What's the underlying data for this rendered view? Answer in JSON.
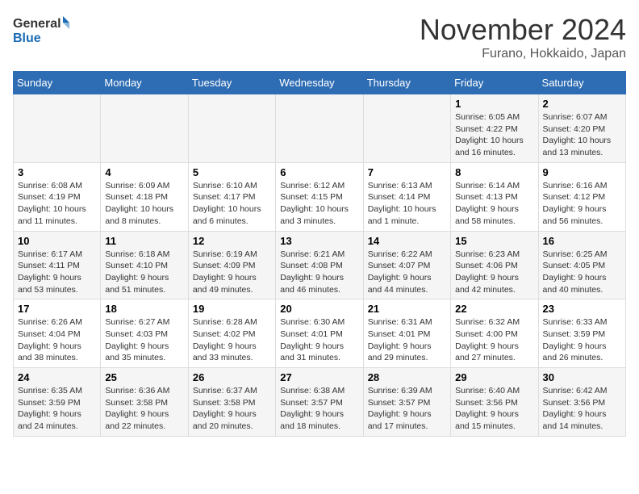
{
  "logo": {
    "general": "General",
    "blue": "Blue"
  },
  "title": "November 2024",
  "location": "Furano, Hokkaido, Japan",
  "weekdays": [
    "Sunday",
    "Monday",
    "Tuesday",
    "Wednesday",
    "Thursday",
    "Friday",
    "Saturday"
  ],
  "weeks": [
    [
      {
        "day": "",
        "info": ""
      },
      {
        "day": "",
        "info": ""
      },
      {
        "day": "",
        "info": ""
      },
      {
        "day": "",
        "info": ""
      },
      {
        "day": "",
        "info": ""
      },
      {
        "day": "1",
        "info": "Sunrise: 6:05 AM\nSunset: 4:22 PM\nDaylight: 10 hours and 16 minutes."
      },
      {
        "day": "2",
        "info": "Sunrise: 6:07 AM\nSunset: 4:20 PM\nDaylight: 10 hours and 13 minutes."
      }
    ],
    [
      {
        "day": "3",
        "info": "Sunrise: 6:08 AM\nSunset: 4:19 PM\nDaylight: 10 hours and 11 minutes."
      },
      {
        "day": "4",
        "info": "Sunrise: 6:09 AM\nSunset: 4:18 PM\nDaylight: 10 hours and 8 minutes."
      },
      {
        "day": "5",
        "info": "Sunrise: 6:10 AM\nSunset: 4:17 PM\nDaylight: 10 hours and 6 minutes."
      },
      {
        "day": "6",
        "info": "Sunrise: 6:12 AM\nSunset: 4:15 PM\nDaylight: 10 hours and 3 minutes."
      },
      {
        "day": "7",
        "info": "Sunrise: 6:13 AM\nSunset: 4:14 PM\nDaylight: 10 hours and 1 minute."
      },
      {
        "day": "8",
        "info": "Sunrise: 6:14 AM\nSunset: 4:13 PM\nDaylight: 9 hours and 58 minutes."
      },
      {
        "day": "9",
        "info": "Sunrise: 6:16 AM\nSunset: 4:12 PM\nDaylight: 9 hours and 56 minutes."
      }
    ],
    [
      {
        "day": "10",
        "info": "Sunrise: 6:17 AM\nSunset: 4:11 PM\nDaylight: 9 hours and 53 minutes."
      },
      {
        "day": "11",
        "info": "Sunrise: 6:18 AM\nSunset: 4:10 PM\nDaylight: 9 hours and 51 minutes."
      },
      {
        "day": "12",
        "info": "Sunrise: 6:19 AM\nSunset: 4:09 PM\nDaylight: 9 hours and 49 minutes."
      },
      {
        "day": "13",
        "info": "Sunrise: 6:21 AM\nSunset: 4:08 PM\nDaylight: 9 hours and 46 minutes."
      },
      {
        "day": "14",
        "info": "Sunrise: 6:22 AM\nSunset: 4:07 PM\nDaylight: 9 hours and 44 minutes."
      },
      {
        "day": "15",
        "info": "Sunrise: 6:23 AM\nSunset: 4:06 PM\nDaylight: 9 hours and 42 minutes."
      },
      {
        "day": "16",
        "info": "Sunrise: 6:25 AM\nSunset: 4:05 PM\nDaylight: 9 hours and 40 minutes."
      }
    ],
    [
      {
        "day": "17",
        "info": "Sunrise: 6:26 AM\nSunset: 4:04 PM\nDaylight: 9 hours and 38 minutes."
      },
      {
        "day": "18",
        "info": "Sunrise: 6:27 AM\nSunset: 4:03 PM\nDaylight: 9 hours and 35 minutes."
      },
      {
        "day": "19",
        "info": "Sunrise: 6:28 AM\nSunset: 4:02 PM\nDaylight: 9 hours and 33 minutes."
      },
      {
        "day": "20",
        "info": "Sunrise: 6:30 AM\nSunset: 4:01 PM\nDaylight: 9 hours and 31 minutes."
      },
      {
        "day": "21",
        "info": "Sunrise: 6:31 AM\nSunset: 4:01 PM\nDaylight: 9 hours and 29 minutes."
      },
      {
        "day": "22",
        "info": "Sunrise: 6:32 AM\nSunset: 4:00 PM\nDaylight: 9 hours and 27 minutes."
      },
      {
        "day": "23",
        "info": "Sunrise: 6:33 AM\nSunset: 3:59 PM\nDaylight: 9 hours and 26 minutes."
      }
    ],
    [
      {
        "day": "24",
        "info": "Sunrise: 6:35 AM\nSunset: 3:59 PM\nDaylight: 9 hours and 24 minutes."
      },
      {
        "day": "25",
        "info": "Sunrise: 6:36 AM\nSunset: 3:58 PM\nDaylight: 9 hours and 22 minutes."
      },
      {
        "day": "26",
        "info": "Sunrise: 6:37 AM\nSunset: 3:58 PM\nDaylight: 9 hours and 20 minutes."
      },
      {
        "day": "27",
        "info": "Sunrise: 6:38 AM\nSunset: 3:57 PM\nDaylight: 9 hours and 18 minutes."
      },
      {
        "day": "28",
        "info": "Sunrise: 6:39 AM\nSunset: 3:57 PM\nDaylight: 9 hours and 17 minutes."
      },
      {
        "day": "29",
        "info": "Sunrise: 6:40 AM\nSunset: 3:56 PM\nDaylight: 9 hours and 15 minutes."
      },
      {
        "day": "30",
        "info": "Sunrise: 6:42 AM\nSunset: 3:56 PM\nDaylight: 9 hours and 14 minutes."
      }
    ]
  ]
}
